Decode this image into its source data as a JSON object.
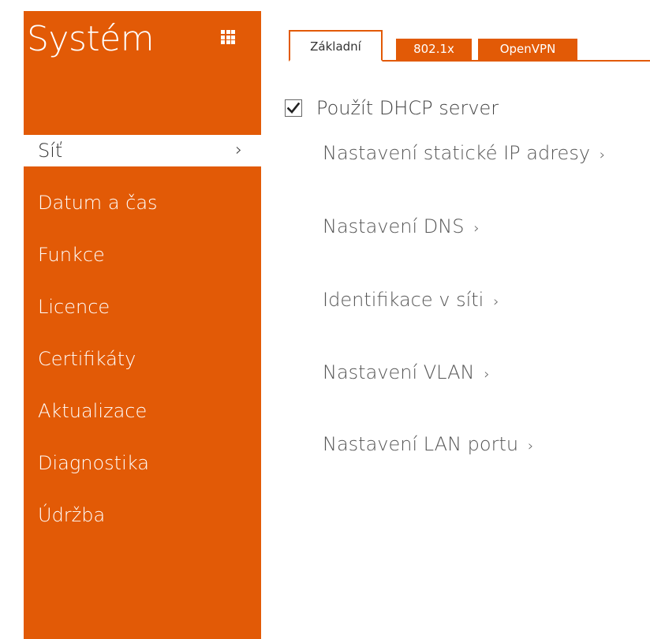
{
  "sidebar": {
    "title": "Systém",
    "items": [
      {
        "label": "Síť",
        "active": true
      },
      {
        "label": "Datum a čas"
      },
      {
        "label": "Funkce"
      },
      {
        "label": "Licence"
      },
      {
        "label": "Certifikáty"
      },
      {
        "label": "Aktualizace"
      },
      {
        "label": "Diagnostika"
      },
      {
        "label": "Údržba"
      }
    ]
  },
  "tabs": [
    {
      "label": "Základní",
      "active": true
    },
    {
      "label": "802.1x"
    },
    {
      "label": "OpenVPN"
    }
  ],
  "content": {
    "dhcp_label": "Použít DHCP server",
    "dhcp_checked": true,
    "links": [
      "Nastavení statické IP adresy",
      "Nastavení DNS",
      "Identifikace v síti",
      "Nastavení VLAN",
      "Nastavení LAN portu"
    ]
  },
  "icons": {
    "app_grid": "grid-icon",
    "chevron": "chevron-right-icon",
    "check": "check-icon"
  },
  "colors": {
    "accent": "#e25a06",
    "text": "#444444"
  }
}
